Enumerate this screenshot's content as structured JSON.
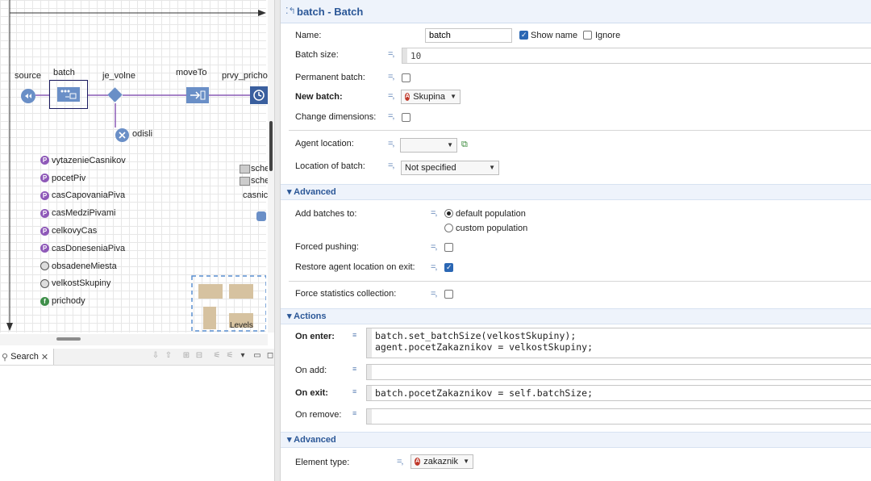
{
  "editor": {
    "blocks": [
      {
        "label": "source"
      },
      {
        "label": "batch"
      },
      {
        "label": "je_volne"
      },
      {
        "label": "moveTo"
      },
      {
        "label": "prvy_prichod"
      },
      {
        "label": "odisli"
      }
    ],
    "variables": [
      {
        "name": "vytazenieCasnikov",
        "kind": "parameter"
      },
      {
        "name": "pocetPiv",
        "kind": "parameter"
      },
      {
        "name": "casCapovaniaPiva",
        "kind": "parameter"
      },
      {
        "name": "casMedziPivami",
        "kind": "parameter"
      },
      {
        "name": "celkovyCas",
        "kind": "parameter"
      },
      {
        "name": "casDoneseniaPiva",
        "kind": "parameter"
      },
      {
        "name": "obsadeneMiesta",
        "kind": "dataset"
      },
      {
        "name": "velkostSkupiny",
        "kind": "dataset"
      },
      {
        "name": "prichody",
        "kind": "function"
      }
    ],
    "right_items": [
      "sche",
      "sche",
      "casnic"
    ],
    "levels_label": "Levels"
  },
  "search_view": {
    "tab_label": "Search"
  },
  "properties": {
    "title": "batch - Batch",
    "name_label": "Name:",
    "name_value": "batch",
    "show_name_label": "Show name",
    "show_name_checked": true,
    "ignore_label": "Ignore",
    "ignore_checked": false,
    "batch_size_label": "Batch size:",
    "batch_size_value": "10",
    "permanent_batch_label": "Permanent batch:",
    "new_batch_label": "New batch:",
    "new_batch_value": "Skupina",
    "change_dimensions_label": "Change dimensions:",
    "agent_location_label": "Agent location:",
    "agent_location_value": "",
    "location_of_batch_label": "Location of batch:",
    "location_of_batch_value": "Not specified",
    "advanced_section_1": "Advanced",
    "add_batches_label": "Add batches to:",
    "add_batches_options": [
      "default population",
      "custom population"
    ],
    "add_batches_selected": 0,
    "forced_pushing_label": "Forced pushing:",
    "restore_location_label": "Restore agent location on exit:",
    "restore_location_checked": true,
    "force_stats_label": "Force statistics collection:",
    "actions_section": "Actions",
    "on_enter_label": "On enter:",
    "on_enter_code": [
      "batch.set_batchSize(velkostSkupiny);",
      "agent.pocetZakaznikov = velkostSkupiny;"
    ],
    "on_add_label": "On add:",
    "on_exit_label": "On exit:",
    "on_exit_code": [
      "batch.pocetZakaznikov = self.batchSize;"
    ],
    "on_remove_label": "On remove:",
    "advanced_section_2": "Advanced",
    "element_type_label": "Element type:",
    "element_type_value": "zakaznik"
  },
  "colors": {
    "accent": "#2b5797",
    "block_blue": "#6a8fc7",
    "connector": "#8a5bb5"
  }
}
